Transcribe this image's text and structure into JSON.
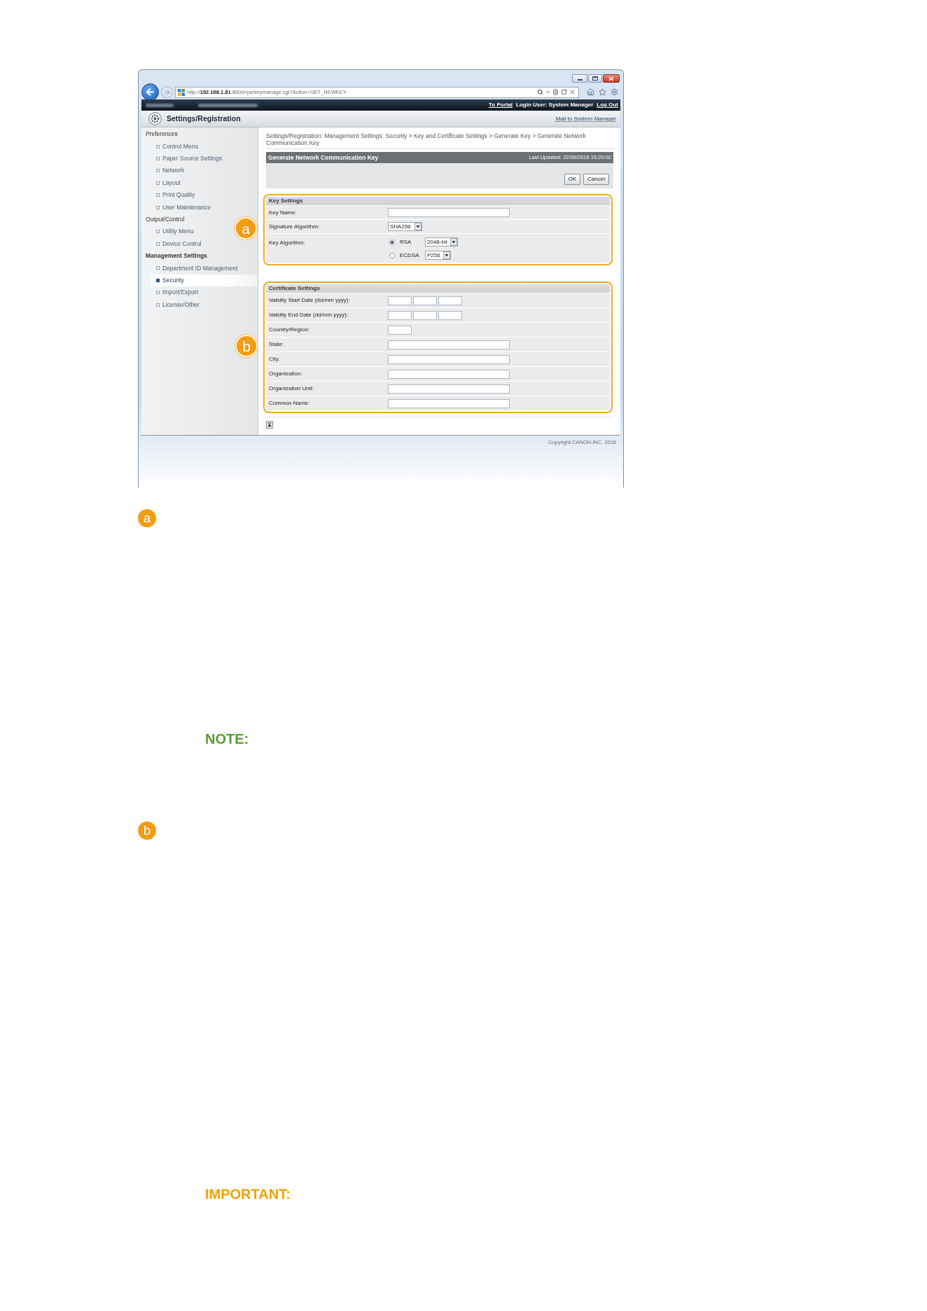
{
  "browser": {
    "address": "http://**192.168.1.81**:8000/rps/keymanage.cgi?Action=GET_NEWKEY"
  },
  "top_bar": {
    "items": [
      {
        "kind": "link",
        "text": "To Portal"
      },
      {
        "kind": "text",
        "text": "Login User: System Manager"
      },
      {
        "kind": "link",
        "text": "Log Out"
      }
    ]
  },
  "app_header": {
    "title": "Settings/Registration",
    "link": "Mail to System Manager"
  },
  "sidebar": {
    "sections": [
      {
        "title": "Preferences",
        "items": [
          {
            "label": "Control Menu",
            "selected": false
          },
          {
            "label": "Paper Source Settings",
            "selected": false
          },
          {
            "label": "Network",
            "selected": false
          },
          {
            "label": "Layout",
            "selected": false
          },
          {
            "label": "Print Quality",
            "selected": false
          },
          {
            "label": "User Maintenance",
            "selected": false
          }
        ]
      },
      {
        "title": "Output/Control",
        "items": [
          {
            "label": "Utility Menu",
            "selected": false
          },
          {
            "label": "Device Control",
            "selected": false
          }
        ]
      },
      {
        "title": "Management Settings",
        "items": [
          {
            "label": "Department ID Management",
            "selected": false
          },
          {
            "label": "Security",
            "selected": true
          },
          {
            "label": "Import/Export",
            "selected": false
          },
          {
            "label": "License/Other",
            "selected": false
          }
        ]
      }
    ]
  },
  "breadcrumb": "Settings/Registration: Management Settings: Security > Key and Certificate Settings > Generate Key > Generate Network Communication Key",
  "page": {
    "title": "Generate Network Communication Key",
    "last_updated": "Last Updated: 22/06/2016 15:20:02",
    "buttons": [
      "OK",
      "Cancel"
    ]
  },
  "key_settings": {
    "callout": "a",
    "title": "Key Settings",
    "rows": [
      {
        "kind": "text",
        "label": "Key Name:"
      },
      {
        "kind": "select",
        "label": "Signature Algorithm:",
        "value": "SHA256"
      },
      {
        "kind": "radio_group",
        "label": "Key Algorithm:",
        "options": [
          {
            "label": "RSA",
            "selected": true,
            "value": "2048-bit"
          },
          {
            "label": "ECDSA",
            "selected": false,
            "value": "P256"
          }
        ]
      }
    ]
  },
  "certificate_settings": {
    "callout": "b",
    "title": "Certificate Settings",
    "rows": [
      {
        "kind": "date",
        "label": "Validity Start Date (dd/mm yyyy):"
      },
      {
        "kind": "date",
        "label": "Validity End Date (dd/mm yyyy):"
      },
      {
        "kind": "short",
        "label": "Country/Region:"
      },
      {
        "kind": "text",
        "label": "State:"
      },
      {
        "kind": "text",
        "label": "City:"
      },
      {
        "kind": "text",
        "label": "Organization:"
      },
      {
        "kind": "text",
        "label": "Organization Unit:"
      },
      {
        "kind": "text",
        "label": "Common Name:"
      }
    ]
  },
  "footer": {
    "copyright": "Copyright CANON INC. 2016"
  },
  "explanations": [
    {
      "badge": "a",
      "callouts": [
        {
          "kind": "note",
          "heading": "NOTE:"
        }
      ]
    },
    {
      "badge": "b",
      "callouts": [
        {
          "kind": "important",
          "heading": "IMPORTANT:"
        }
      ]
    }
  ]
}
